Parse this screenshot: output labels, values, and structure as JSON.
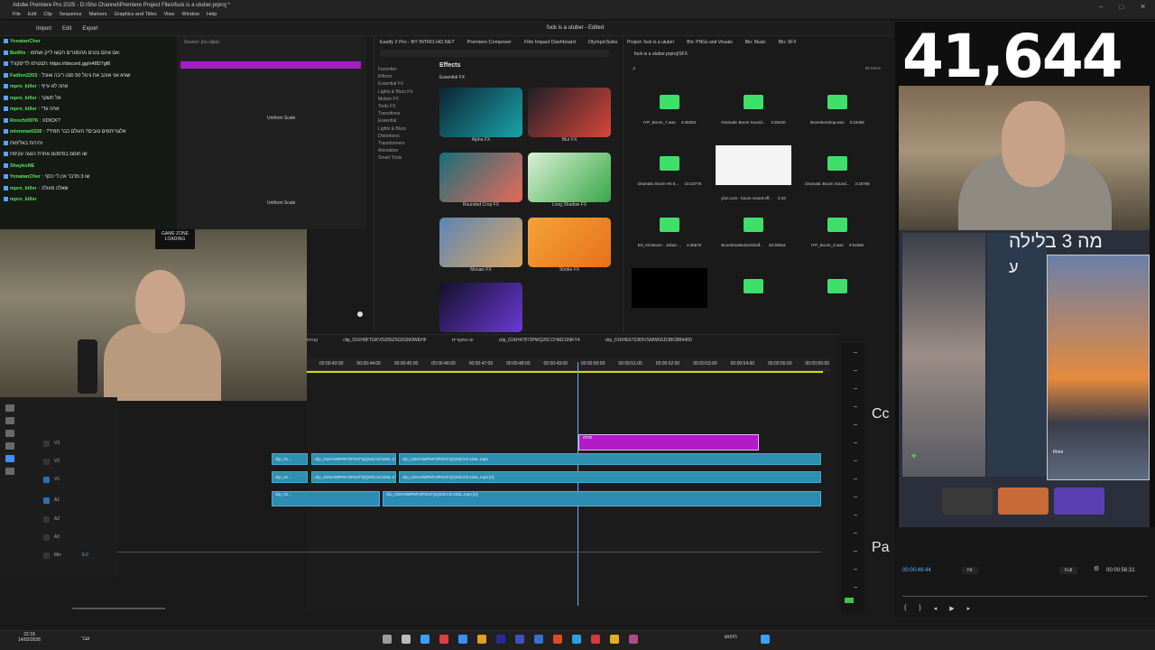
{
  "app": {
    "title": "Adobe Premiere Pro 2025 - D:\\Sho Channel\\Premiere Project Files\\fuck is a utuber.prproj *",
    "menu": [
      "File",
      "Edit",
      "Clip",
      "Sequence",
      "Markers",
      "Graphics and Titles",
      "View",
      "Window",
      "Help"
    ]
  },
  "modebar": {
    "tabs": [
      "Import",
      "Edit",
      "Export"
    ],
    "project_title": "fuck is a utuber - Edited"
  },
  "chat": {
    "lines": [
      {
        "user": "YonatanCher",
        "text": ""
      },
      {
        "user": "BotRix",
        "text": ": אם אתם נהנים מהסטרים הקשו לייק ושתפו:"
      },
      {
        "user": "",
        "text": "תצטרפו לדיסקורד: https://discord.gg/n48D7gf6"
      },
      {
        "user": "Fadlon2203",
        "text": ": שגיא אני אוהב את גיטל 50 סנט ריבה ואוכל"
      },
      {
        "user": "mpro_killer",
        "text": ": אחה לא עייף"
      },
      {
        "user": "mpro_killer",
        "text": ": אל תשקר"
      },
      {
        "user": "mpro_killer",
        "text": ": אחה עדי"
      },
      {
        "user": "Ronchi0976",
        "text": ": XDICK?"
      },
      {
        "user": "mlnnmat4328",
        "text": ": ?אלגוריתמים טובים? העולם כבר תמיד"
      },
      {
        "user": "",
        "text": "זהירות באלימות"
      },
      {
        "user": "",
        "text": "שו חוסם בסיסטם אחרת הגעה עקיפת"
      },
      {
        "user": "ShaykoNE",
        "text": ""
      },
      {
        "user": "YonatanCher",
        "text": ": שו 3 מדבר אין לי כסף"
      },
      {
        "user": "mpro_killer",
        "text": ": שאלה מעולה"
      },
      {
        "user": "mpro_killer",
        "text": ""
      }
    ]
  },
  "effect_controls": {
    "source": "Source: (no clips)",
    "props": [
      "Uniform Scale",
      "Uniform Scale"
    ]
  },
  "webcam": {
    "sign": "GAME ZONE",
    "sign2": "LOADING"
  },
  "effects": {
    "tabs": [
      "Easify 2 Pro - BY INTRO-HD.NET",
      "Premiere Composer",
      "Film Impact Dashboard",
      "OlympicSubs"
    ],
    "header": "Effects",
    "subheader": "Essential FX",
    "tree": [
      "Favorites",
      "Effects",
      "Essential FX",
      "Lights & Blurs FX",
      "Motion FX",
      "Tools FX",
      "Transitions",
      "Essential",
      "Lights & Blurs",
      "Distortions",
      "Transformers",
      "Animation",
      "Smart Tools"
    ],
    "cards": [
      {
        "label": "Alpha FX",
        "c1": "#0e2434",
        "c2": "#1aa3a8"
      },
      {
        "label": "Blur FX",
        "c1": "#1f1f2a",
        "c2": "#d8473a"
      },
      {
        "label": "Rounded Crop FX",
        "c1": "#1a6f7a",
        "c2": "#e86a5a"
      },
      {
        "label": "Long Shadow FX",
        "c1": "#d9efd4",
        "c2": "#3aa84a"
      },
      {
        "label": "Mosaic FX",
        "c1": "#5c86b5",
        "c2": "#d9a562"
      },
      {
        "label": "Stroke FX",
        "c1": "#f2a33a",
        "c2": "#e8701a"
      },
      {
        "label": "",
        "c1": "#14102a",
        "c2": "#6b3ad6"
      }
    ]
  },
  "project": {
    "tabs": [
      "Project: fuck is a utuber",
      "Bin: PNGs and Visuals",
      "Bin: Music",
      "Bin: SFX"
    ],
    "path": "fuck is a utuber.prproj\\SFX",
    "count": "95 Items",
    "items": [
      {
        "name": "IYP_Boom_7.wav",
        "dur": "4:35253"
      },
      {
        "name": "Dramatic Boom Sound...",
        "dur": "3:26420"
      },
      {
        "name": "BoomboxStop.wav",
        "dur": "0:18496"
      },
      {
        "name": "Dramatic Boom Hit E...",
        "dur": "10:18776"
      },
      {
        "name": "yt1s.com - boom sound eff...",
        "dur": "2:19"
      },
      {
        "name": "Dramatic Boom Sound...",
        "dur": "3:16768"
      },
      {
        "name": "ES_Hit Boom - Johan ...",
        "dur": "2:36570"
      },
      {
        "name": "BoomboxMusicSZndf...",
        "dur": "33:30844"
      },
      {
        "name": "IYP_Boom_3.wav",
        "dur": "3:51500"
      },
      {
        "name": "",
        "dur": ""
      },
      {
        "name": "",
        "dur": ""
      },
      {
        "name": "",
        "dur": ""
      }
    ]
  },
  "timeline": {
    "seq_tabs": [
      "קרחת",
      "clip_01KH9FTGKVDZ66Z5G0GM3WEHF",
      "ים המקורית",
      "clip_01KH47873PWQ26CCHM2109KY4",
      "clip_01KHE576365VSMW6GD3BCBB4400"
    ],
    "ruler": [
      "00:00:43:00",
      "00:00:44:00",
      "00:00:45:00",
      "00:00:46:00",
      "00:00:47:00",
      "00:00:48:00",
      "00:00:49:00",
      "00:00:50:00",
      "00:00:51:00",
      "00:00:52:00",
      "00:00:53:00",
      "00:00:54:00",
      "00:00:55:00",
      "00:00:56:00"
    ],
    "tracks": [
      "V3",
      "V2",
      "V1",
      "A1",
      "A2",
      "A3",
      "Mix"
    ],
    "mix_value": "0.0",
    "clip_v2": "clip_01KH4WPMY3PDCFQQS3CHC1DeL.mp4",
    "clip_v1": "clip_01KH4WPMY3PDCFQQS3CHC1DeL.mp4 [V]",
    "clip_a1": "clip_01KH4WPMY3PDCFQQS3CHC1DeL.mp4 [A]",
    "clip_short": "clip_01...",
    "gfx_label": "מחה"
  },
  "right_labels": {
    "top": "Cc",
    "bottom": "Pa"
  },
  "stream": {
    "counter": "41,644",
    "story_text": "מה 3 בלילה",
    "story_letter": "ע",
    "story_name": "Roni"
  },
  "program": {
    "timecode": "00:00:49:44",
    "fit": "Fit",
    "quality": "Full",
    "duration": "00:00:56:31"
  },
  "taskbar": {
    "time": "22:18",
    "date": "14/02/2026",
    "lang": "עבר",
    "search": "חיפוש",
    "time_right": "",
    "date_right": ""
  }
}
